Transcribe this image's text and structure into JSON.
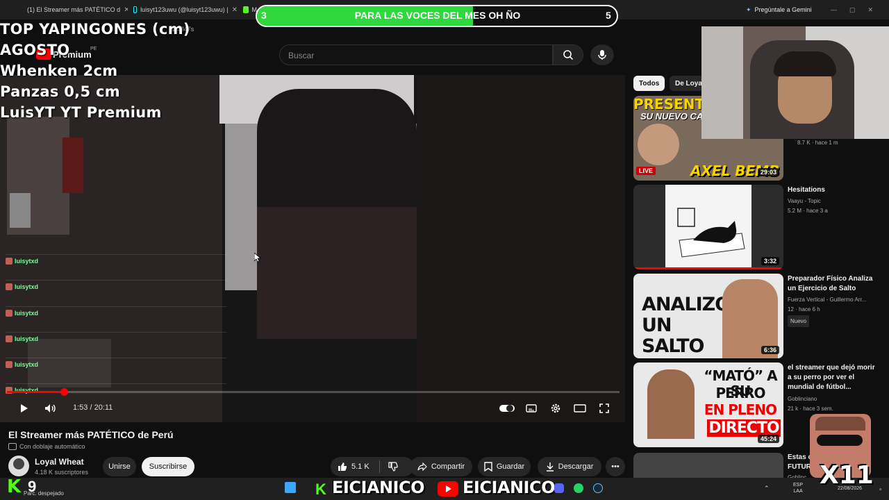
{
  "browser": {
    "tabs": [
      {
        "label": "(1) El Streamer más PATÉTICO d",
        "color": "#ff3344"
      },
      {
        "label": "luisyt123uwu (@luisyt123uwu) |",
        "color": "#111111"
      },
      {
        "label": "M",
        "color": "#53fc18"
      }
    ],
    "url_fragment": "&t=847s",
    "gemini_button": "Pregúntale a Gemini"
  },
  "goal_bar": {
    "left_number": "3",
    "text": "PARA LAS VOCES DEL MES OH ÑO",
    "right_number": "5",
    "progress": 0.6,
    "fill_color": "#2fd83c"
  },
  "overlay": {
    "lines": [
      "TOP YAPINGONES (cm)",
      "AGOSTO",
      "Whenken 2cm",
      "Panzas 0,5 cm",
      "LuisYT YT Premium"
    ]
  },
  "youtube": {
    "logo_text": "Premium",
    "logo_suffix": "PE",
    "search_placeholder": "Buscar",
    "player": {
      "time": "1:53 / 20:11",
      "progress": 0.093
    },
    "chat": {
      "username": "luisytxd",
      "rows": 6
    },
    "video_title": "El Streamer más PATÉTICO de Perú",
    "dubbing_note": "Con doblaje automático",
    "channel_name": "Loyal Wheat",
    "subscribers": "4.18 K suscriptores",
    "join_label": "Unirse",
    "subscribe_label": "Suscribirse",
    "likes": "5.1 K",
    "share_label": "Compartir",
    "save_label": "Guardar",
    "download_label": "Descargar",
    "chips": [
      "Todos",
      "De Loyal"
    ],
    "recommendations": [
      {
        "thumb_text_top": "PRESENTA",
        "thumb_text_mid": "SU NUEVO CA",
        "thumb_text_bottom": "AXEL BEMB",
        "live": "LIVE",
        "duration": "29:03",
        "meta": "8.7 K · hace 1 m"
      },
      {
        "title": "Hesitations",
        "channel": "Vaayu - Topic",
        "meta": "5.2 M · hace 3 a",
        "duration": "3:32"
      },
      {
        "title": "Preparador Físico Analiza un Ejercicio de Salto",
        "channel": "Fuerza Vertical - Guillermo Arr...",
        "meta": "12 · hace 6 h",
        "badge": "Nuevo",
        "thumb_text": "ANALIZO UN SALTO",
        "duration": "6:36"
      },
      {
        "title": "el streamer que dejó morir a su perro por ver el mundial de fútbol...",
        "channel": "Goblinciano",
        "meta": "21 k · hace 3 sem.",
        "thumb_text_1": "“MATÓ” A SU",
        "thumb_text_2": "PERRO",
        "thumb_text_3": "EN PLENO",
        "thumb_text_4": "DIRECTO",
        "duration": "45:24"
      },
      {
        "title": "Estas c...",
        "line2": "FUTUR...",
        "channel": "Goblinc..."
      }
    ]
  },
  "taskbar": {
    "kick_letter": "K",
    "kick_count": "9",
    "weather": "Parc. despejado",
    "brand_1": "EICIANICO",
    "brand_2": "EICIANICO",
    "multiplier": "X11",
    "lang_line1": "ESP",
    "lang_line2": "LAA",
    "date": "22/08/2026"
  }
}
